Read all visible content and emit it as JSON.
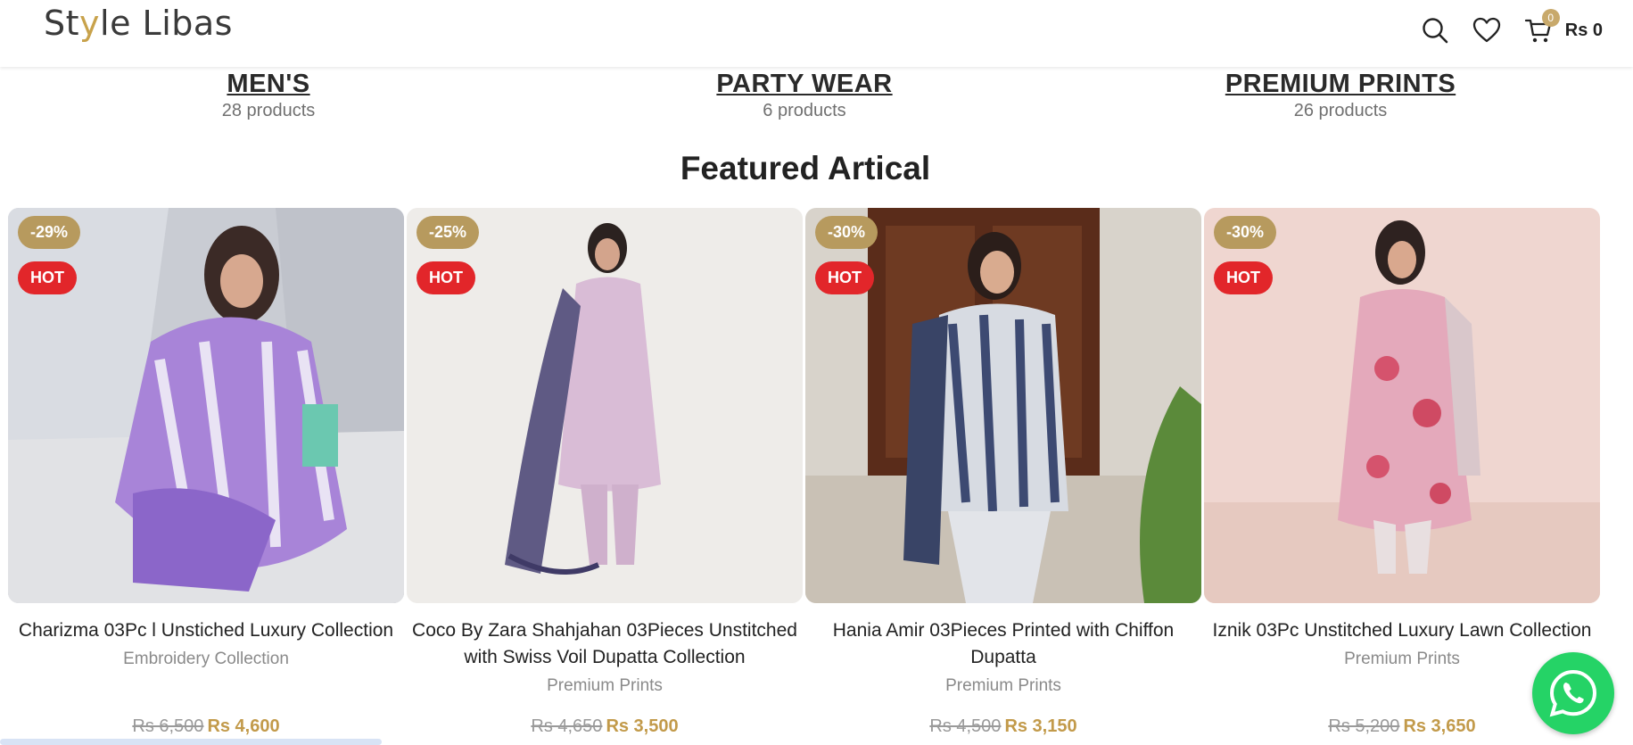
{
  "header": {
    "logo_pre": "St",
    "logo_accent": "y",
    "logo_post": "le Libas",
    "cart_count": "0",
    "cart_total": "Rs 0",
    "icons": [
      "search-icon",
      "heart-icon",
      "cart-icon"
    ]
  },
  "categories": [
    {
      "title": "MEN'S",
      "count": "28 products"
    },
    {
      "title": "PARTY WEAR",
      "count": "6 products"
    },
    {
      "title": "PREMIUM PRINTS",
      "count": "26 products"
    }
  ],
  "section_title": "Featured Artical",
  "products": [
    {
      "discount": "-29%",
      "hot": "HOT",
      "title": "Charizma 03Pc l Unstiched Luxury Collection",
      "category": "Embroidery Collection",
      "old_price": "Rs 6,500",
      "new_price": "Rs 4,600"
    },
    {
      "discount": "-25%",
      "hot": "HOT",
      "title": "Coco By Zara Shahjahan 03Pieces Unstitched with Swiss Voil Dupatta Collection",
      "category": "Premium Prints",
      "old_price": "Rs 4,650",
      "new_price": "Rs 3,500"
    },
    {
      "discount": "-30%",
      "hot": "HOT",
      "title": "Hania Amir 03Pieces Printed with Chiffon Dupatta",
      "category": "Premium Prints",
      "old_price": "Rs 4,500",
      "new_price": "Rs 3,150"
    },
    {
      "discount": "-30%",
      "hot": "HOT",
      "title": "Iznik 03Pc Unstitched Luxury Lawn Collection",
      "category": "Premium Prints",
      "old_price": "Rs 5,200",
      "new_price": "Rs 3,650"
    }
  ],
  "colors": {
    "accent": "#c8a24b",
    "hot_badge": "#e2262a",
    "discount_badge": "#b79a5e",
    "whatsapp": "#25d366"
  }
}
